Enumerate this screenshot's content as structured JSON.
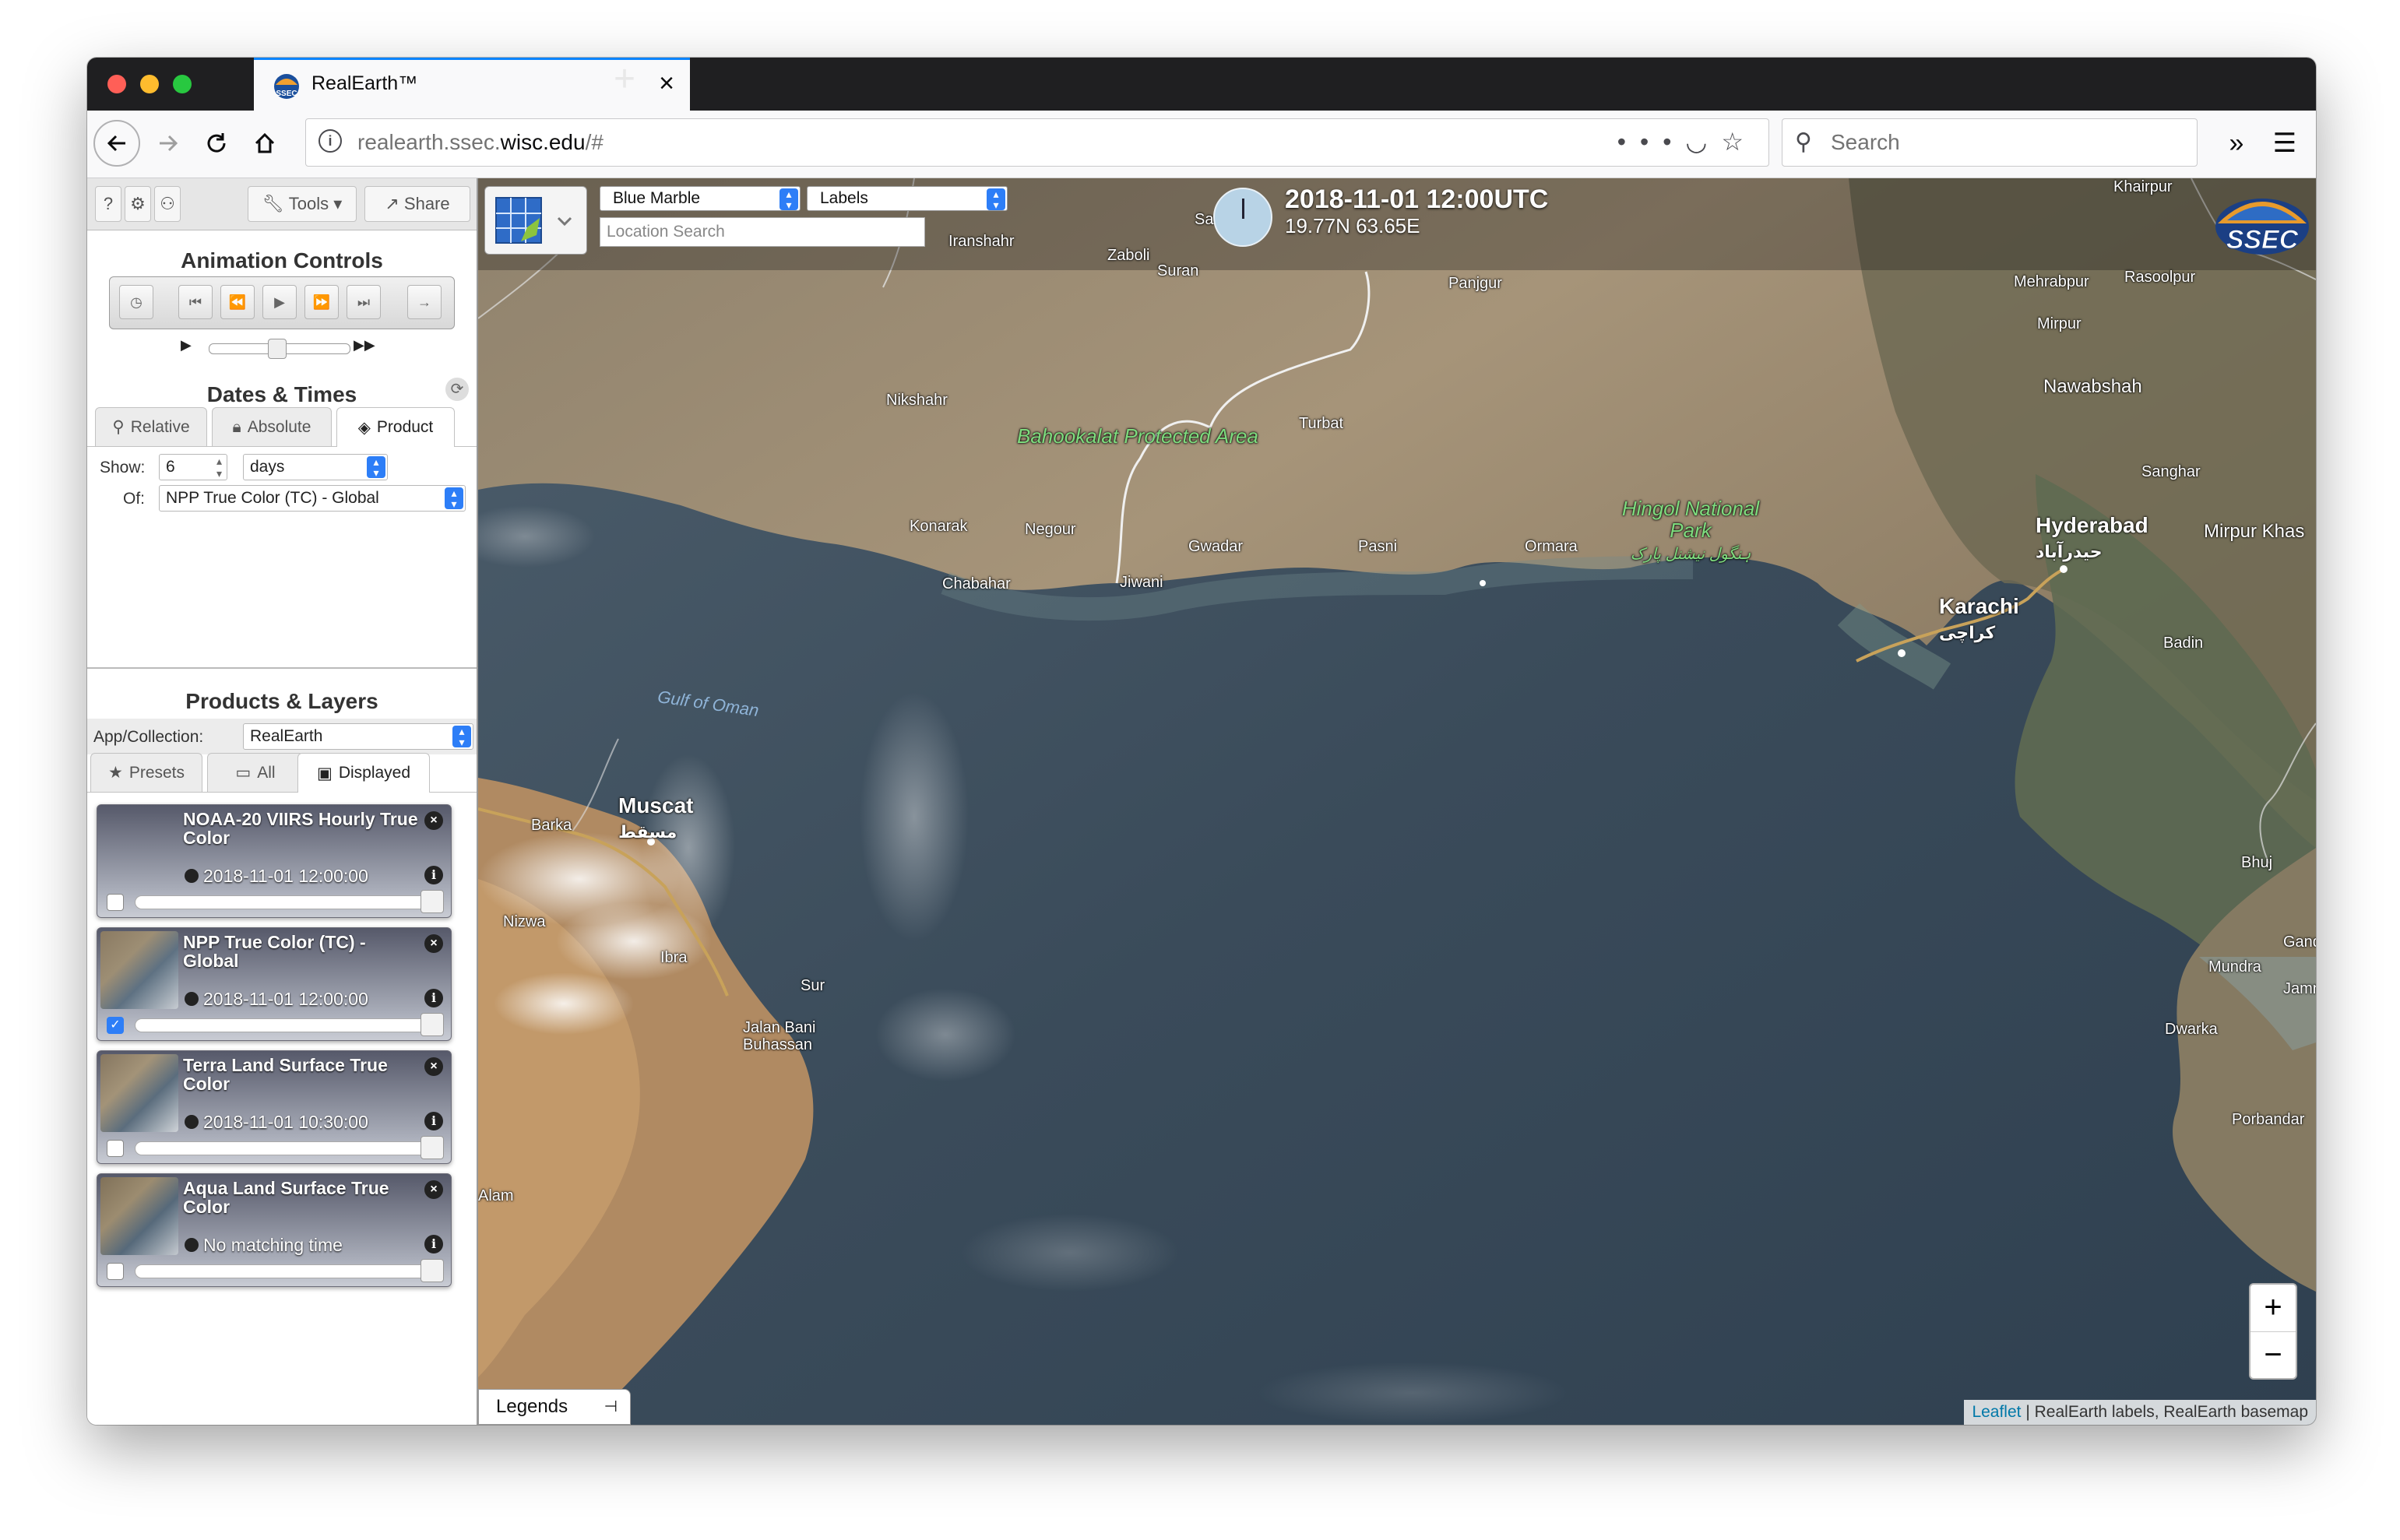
{
  "browser": {
    "tab_title": "RealEarth™",
    "url_host": "realearth.ssec.",
    "url_domain": "wisc.edu",
    "url_path": "/#",
    "search_placeholder": "Search",
    "traffic_colors": {
      "close": "#ff5f57",
      "minimize": "#febc2e",
      "zoom": "#28c840"
    }
  },
  "sidebar": {
    "top_buttons": {
      "help": "?",
      "settings": "⚙",
      "user": "⚇",
      "tools": "Tools",
      "share": "Share"
    },
    "animation": {
      "title": "Animation Controls"
    },
    "dates": {
      "title": "Dates & Times",
      "tabs": [
        "Relative",
        "Absolute",
        "Product"
      ],
      "active_tab": "Product",
      "show_label": "Show:",
      "show_value": "6",
      "show_unit": "days",
      "of_label": "Of:",
      "of_value": "NPP True Color (TC) - Global"
    },
    "products": {
      "title": "Products & Layers",
      "collection_label": "App/Collection:",
      "collection_value": "RealEarth",
      "tabs": [
        "Presets",
        "All",
        "Displayed"
      ],
      "active_tab": "Displayed",
      "layers": [
        {
          "title": "NOAA-20 VIIRS Hourly True Color",
          "time": "2018-11-01 12:00:00",
          "checked": false
        },
        {
          "title": "NPP True Color (TC) - Global",
          "time": "2018-11-01 12:00:00",
          "checked": true
        },
        {
          "title": "Terra Land Surface True Color",
          "time": "2018-11-01 10:30:00",
          "checked": false
        },
        {
          "title": "Aqua Land Surface True Color",
          "time": "No matching time",
          "checked": false
        }
      ]
    }
  },
  "map": {
    "basemap_select": "Blue Marble",
    "labels_select": "Labels",
    "location_placeholder": "Location Search",
    "datetime": "2018-11-01 12:00UTC",
    "coords": "19.77N 63.65E",
    "logo": "SSEC",
    "zoom_in": "+",
    "zoom_out": "−",
    "legends": "Legends",
    "attribution_link": "Leaflet",
    "attribution_text": "| RealEarth labels, RealEarth basemap",
    "labels": {
      "karachi": "Karachi",
      "karachi_ur": "کراچی",
      "hyderabad": "Hyderabad",
      "hyderabad_ur": "حیدرآباد",
      "muscat": "Muscat",
      "muscat_ar": "مسقط",
      "gulf": "Gulf of Oman",
      "bahookalat": "Bahookalat Protected Area",
      "hingol": "Hingol National Park",
      "hingol_ur": "ہنگول نیشنل پارک",
      "turbat": "Turbat",
      "gwadar": "Gwadar",
      "pasni": "Pasni",
      "ormara": "Ormara",
      "jiwani": "Jiwani",
      "chabahar": "Chabahar",
      "konarak": "Konarak",
      "negour": "Negour",
      "nikshahr": "Nikshahr",
      "iranshahr": "Iranshahr",
      "zaboli": "Zaboli",
      "suran": "Suran",
      "panjgur": "Panjgur",
      "khairpur": "Khairpur",
      "mehrabpur": "Mehrabpur",
      "rasoolpur": "Rasoolpur",
      "mirpur": "Mirpur",
      "nawabshah": "Nawabshah",
      "sanghar": "Sanghar",
      "mirpurkhas": "Mirpur Khas",
      "badin": "Badin",
      "bhuj": "Bhuj",
      "gandhi": "Gandl",
      "mundra": "Mundra",
      "jamn": "Jamn",
      "dwarka": "Dwarka",
      "porbandar": "Porbandar",
      "barka": "Barka",
      "nizwa": "Nizwa",
      "ibra": "Ibra",
      "sur": "Sur",
      "jalan": "Jalan Bani Buhassan",
      "alam": "Alam",
      "sar": "Sar"
    }
  }
}
